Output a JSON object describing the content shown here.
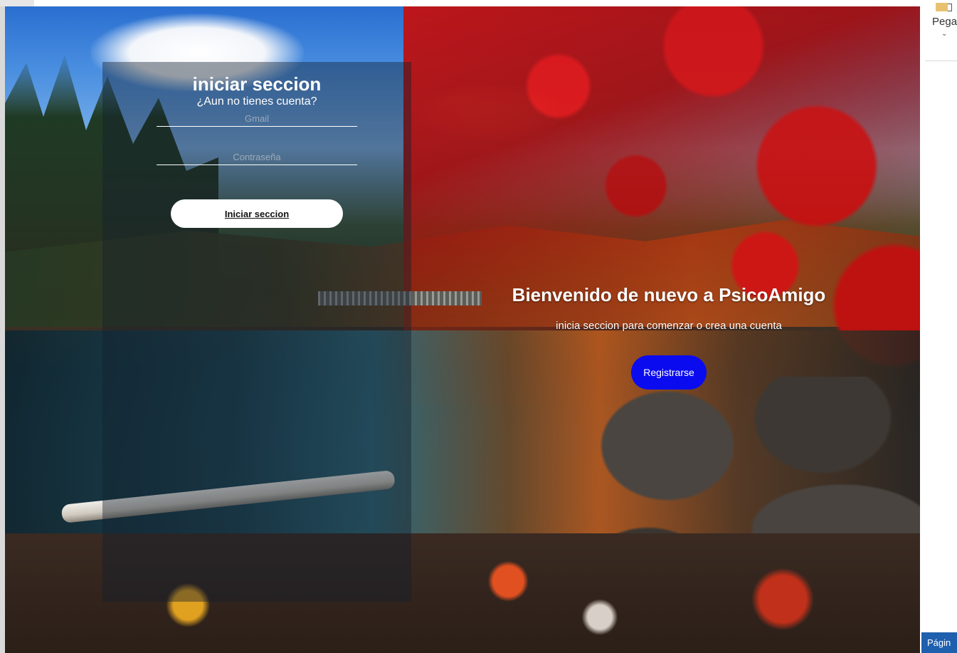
{
  "login": {
    "title": "iniciar seccion",
    "subtitle": "¿Aun no tienes cuenta?",
    "email_placeholder": "Gmail",
    "password_placeholder": "Contraseña",
    "submit_label": "Iniciar seccion"
  },
  "welcome": {
    "title": "Bienvenido de nuevo a PsicoAmigo",
    "subtitle": "inicia seccion para comenzar o crea una cuenta",
    "register_label": "Registrarse"
  },
  "side_window": {
    "paste_label": "Pega",
    "chevron": "⌄",
    "status_label": "Págin"
  },
  "colors": {
    "register_button": "#0b0bf0",
    "login_button": "#ffffff",
    "panel_overlay": "rgba(20,30,45,0.42)"
  }
}
